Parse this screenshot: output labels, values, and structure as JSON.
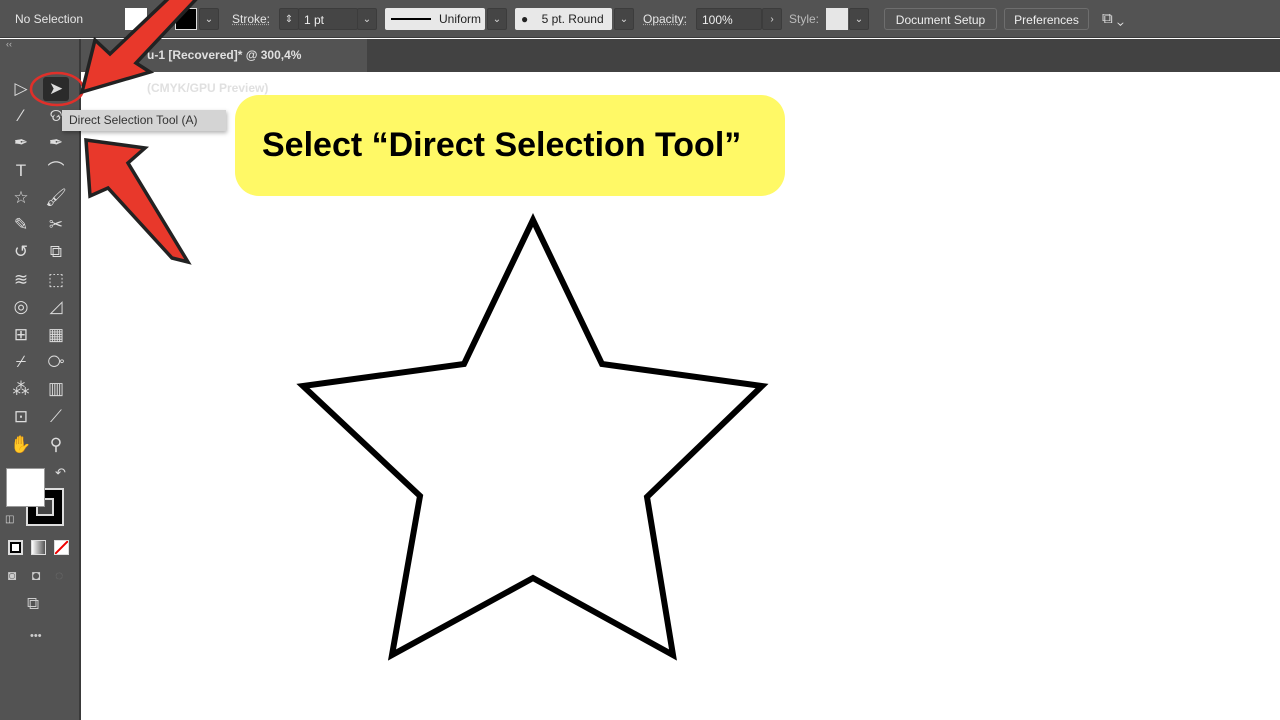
{
  "control_bar": {
    "selection": "No Selection",
    "stroke_label": "Stroke:",
    "stroke_value": "1 pt",
    "profile": "Uniform",
    "brush": "5 pt. Round",
    "opacity_label": "Opacity:",
    "opacity_value": "100%",
    "style_label": "Style:",
    "document_setup": "Document Setup",
    "preferences": "Preferences"
  },
  "document_tab": {
    "title": "u-1 [Recovered]* @ 300,4% (CMYK/GPU Preview)"
  },
  "toolbox": {
    "collapse": "‹‹",
    "tooltip": "Direct Selection Tool (A)",
    "more": "•••",
    "tools": [
      "selection",
      "direct-selection",
      "magic-wand",
      "lasso",
      "pen",
      "curvature",
      "type",
      "arc",
      "star",
      "paintbrush",
      "pencil",
      "scissors",
      "rotate",
      "scale",
      "warp",
      "free-transform",
      "shape-builder",
      "perspective-grid",
      "mesh",
      "gradient",
      "eyedropper",
      "blend",
      "symbol-sprayer",
      "column-graph",
      "artboard",
      "slice",
      "hand",
      "zoom"
    ]
  },
  "callout": {
    "text": "Select “Direct Selection Tool”",
    "color": "#fff966"
  },
  "colors": {
    "arrow": "#e8382b",
    "ui": "#535353"
  }
}
